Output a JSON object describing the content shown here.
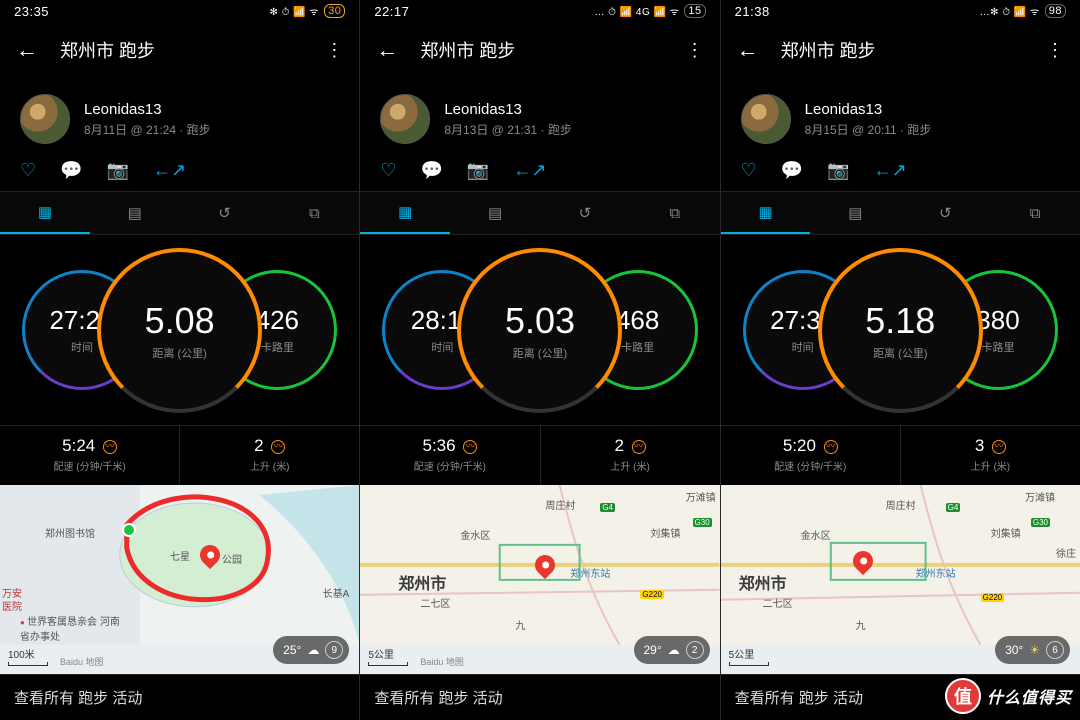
{
  "watermark": "什么值得买",
  "zhi": "值",
  "screens": [
    {
      "status": {
        "time": "23:35",
        "icons": "✻ ⏱ 📶 ᯤ",
        "battery": "30",
        "batt_class": "orange"
      },
      "title": "郑州市 跑步",
      "username": "Leonidas13",
      "meta": "8月11日 @ 21:24 · 跑步",
      "rings": {
        "time": "27:28",
        "time_l": "时间",
        "dist": "5.08",
        "dist_l": "距离 (公里)",
        "cal": "426",
        "cal_l": "卡路里"
      },
      "subs": {
        "pace": "5:24",
        "pace_l": "配速 (分钟/千米)",
        "elev": "2",
        "elev_l": "上升 (米)"
      },
      "map": {
        "scale": "100米",
        "temp": "25°",
        "wicon": "☁",
        "extra": "9",
        "city": "",
        "poi": [
          "郑州图书馆",
          "七星",
          "公园",
          "长基A",
          "万安",
          "医院",
          "世界客属恳亲会 河南省办事处"
        ]
      },
      "footer": "查看所有 跑步 活动"
    },
    {
      "status": {
        "time": "22:17",
        "icons": "… ⏱ 📶 4G 📶 ᯤ",
        "battery": "15",
        "batt_class": ""
      },
      "title": "郑州市 跑步",
      "username": "Leonidas13",
      "meta": "8月13日 @ 21:31 · 跑步",
      "rings": {
        "time": "28:11",
        "time_l": "时间",
        "dist": "5.03",
        "dist_l": "距离 (公里)",
        "cal": "468",
        "cal_l": "卡路里"
      },
      "subs": {
        "pace": "5:36",
        "pace_l": "配速 (分钟/千米)",
        "elev": "2",
        "elev_l": "上升 (米)"
      },
      "map": {
        "scale": "5公里",
        "temp": "29°",
        "wicon": "☁",
        "extra": "2",
        "city": "郑州市",
        "station": "郑州东站",
        "poi": [
          "金水区",
          "二七区",
          "九",
          "刘集镇",
          "万滩镇",
          "周庄村"
        ]
      },
      "footer": "查看所有 跑步 活动"
    },
    {
      "status": {
        "time": "21:38",
        "icons": "…✻ ⏱ 📶 ᯤ",
        "battery": "98",
        "batt_class": ""
      },
      "title": "郑州市 跑步",
      "username": "Leonidas13",
      "meta": "8月15日 @ 20:11 · 跑步",
      "rings": {
        "time": "27:37",
        "time_l": "时间",
        "dist": "5.18",
        "dist_l": "距离 (公里)",
        "cal": "380",
        "cal_l": "卡路里"
      },
      "subs": {
        "pace": "5:20",
        "pace_l": "配速 (分钟/千米)",
        "elev": "3",
        "elev_l": "上升 (米)"
      },
      "map": {
        "scale": "5公里",
        "temp": "30°",
        "wicon": "☀",
        "extra": "6",
        "city": "郑州市",
        "station": "郑州东站",
        "poi": [
          "金水区",
          "二七区",
          "九",
          "刘集镇",
          "万滩镇",
          "周庄村",
          "徐庄"
        ]
      },
      "footer": "查看所有 跑步 活动"
    }
  ]
}
